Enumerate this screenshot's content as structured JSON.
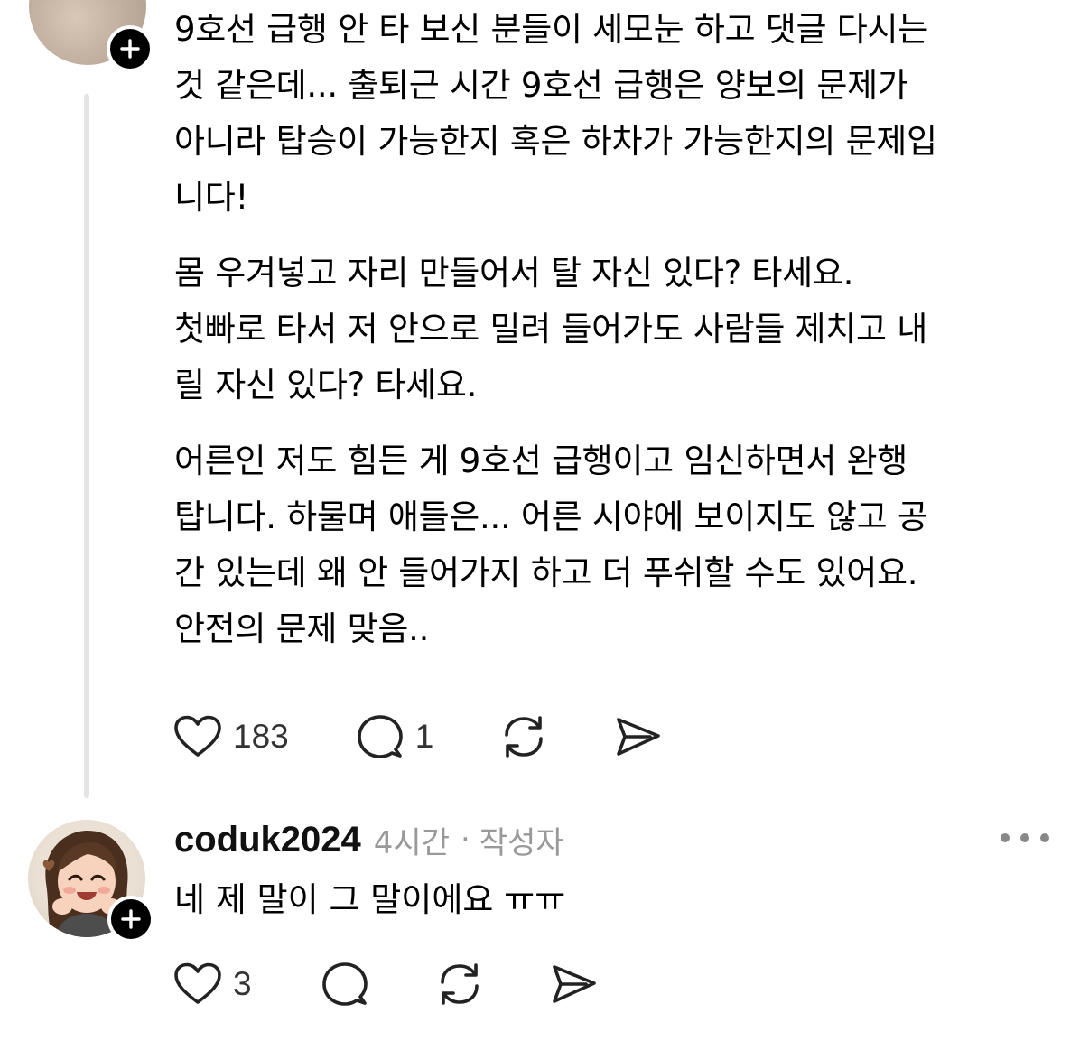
{
  "post": {
    "paragraphs": [
      "9호선 급행 안 타 보신 분들이 세모눈 하고 댓글 다시는\n것 같은데... 출퇴근 시간 9호선 급행은 양보의 문제가\n아니라 탑승이 가능한지 혹은 하차가 가능한지의 문제입\n니다!",
      "몸 우겨넣고 자리 만들어서 탈 자신 있다? 타세요.\n첫빠로 타서 저 안으로 밀려 들어가도 사람들 제치고 내\n릴 자신 있다? 타세요.",
      "어른인 저도 힘든 게 9호선 급행이고 임신하면서 완행\n탑니다. 하물며 애들은... 어른 시야에 보이지도 않고 공\n간 있는데 왜 안 들어가지 하고 더 푸쉬할 수도 있어요.\n안전의 문제 맞음.."
    ],
    "likes": "183",
    "replies": "1",
    "icons": [
      "heart-icon",
      "comment-icon",
      "repost-icon",
      "share-icon",
      "follow-plus-icon"
    ]
  },
  "comment": {
    "username": "coduk2024",
    "time": "4시간",
    "separator": "·",
    "role": "작성자",
    "text": "네 제 말이 그 말이에요 ㅠㅠ",
    "likes": "3",
    "icons": [
      "more-icon",
      "heart-icon",
      "comment-icon",
      "repost-icon",
      "share-icon",
      "follow-plus-icon"
    ]
  },
  "colors": {
    "text": "#000000",
    "meta": "#999999",
    "thread_line": "#e4e4e4",
    "badge": "#000000"
  }
}
